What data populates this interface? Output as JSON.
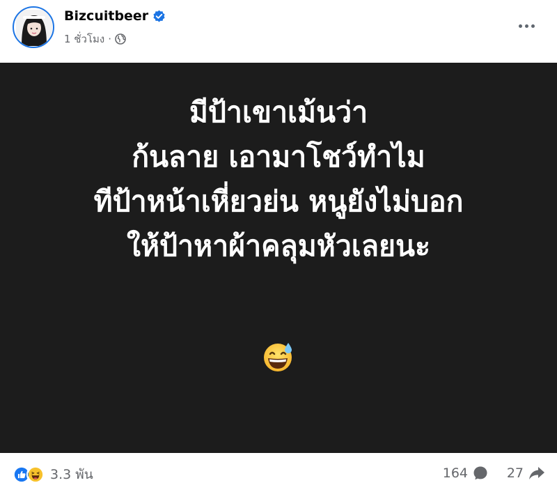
{
  "post": {
    "author": "Bizcuitbeer",
    "time": "1 ชั่วโมง",
    "separator": "·",
    "image_text": [
      "มีป้าเขาเม้นว่า",
      "ก้นลาย เอามาโชว์ทำไม",
      "ทีป้าหน้าเหี่ยวย่น หนูยังไม่บอก",
      "ให้ป้าหาผ้าคลุมหัวเลยนะ"
    ],
    "image_emoji": "grinning-face-with-sweat",
    "colors": {
      "image_bg": "#1c1c1c",
      "verified_blue": "#1b74e4",
      "meta_gray": "#65676b"
    }
  },
  "engagement": {
    "reactions": [
      "like-icon",
      "haha-icon"
    ],
    "reaction_count": "3.3 พัน",
    "comment_count": "164",
    "share_count": "27"
  }
}
